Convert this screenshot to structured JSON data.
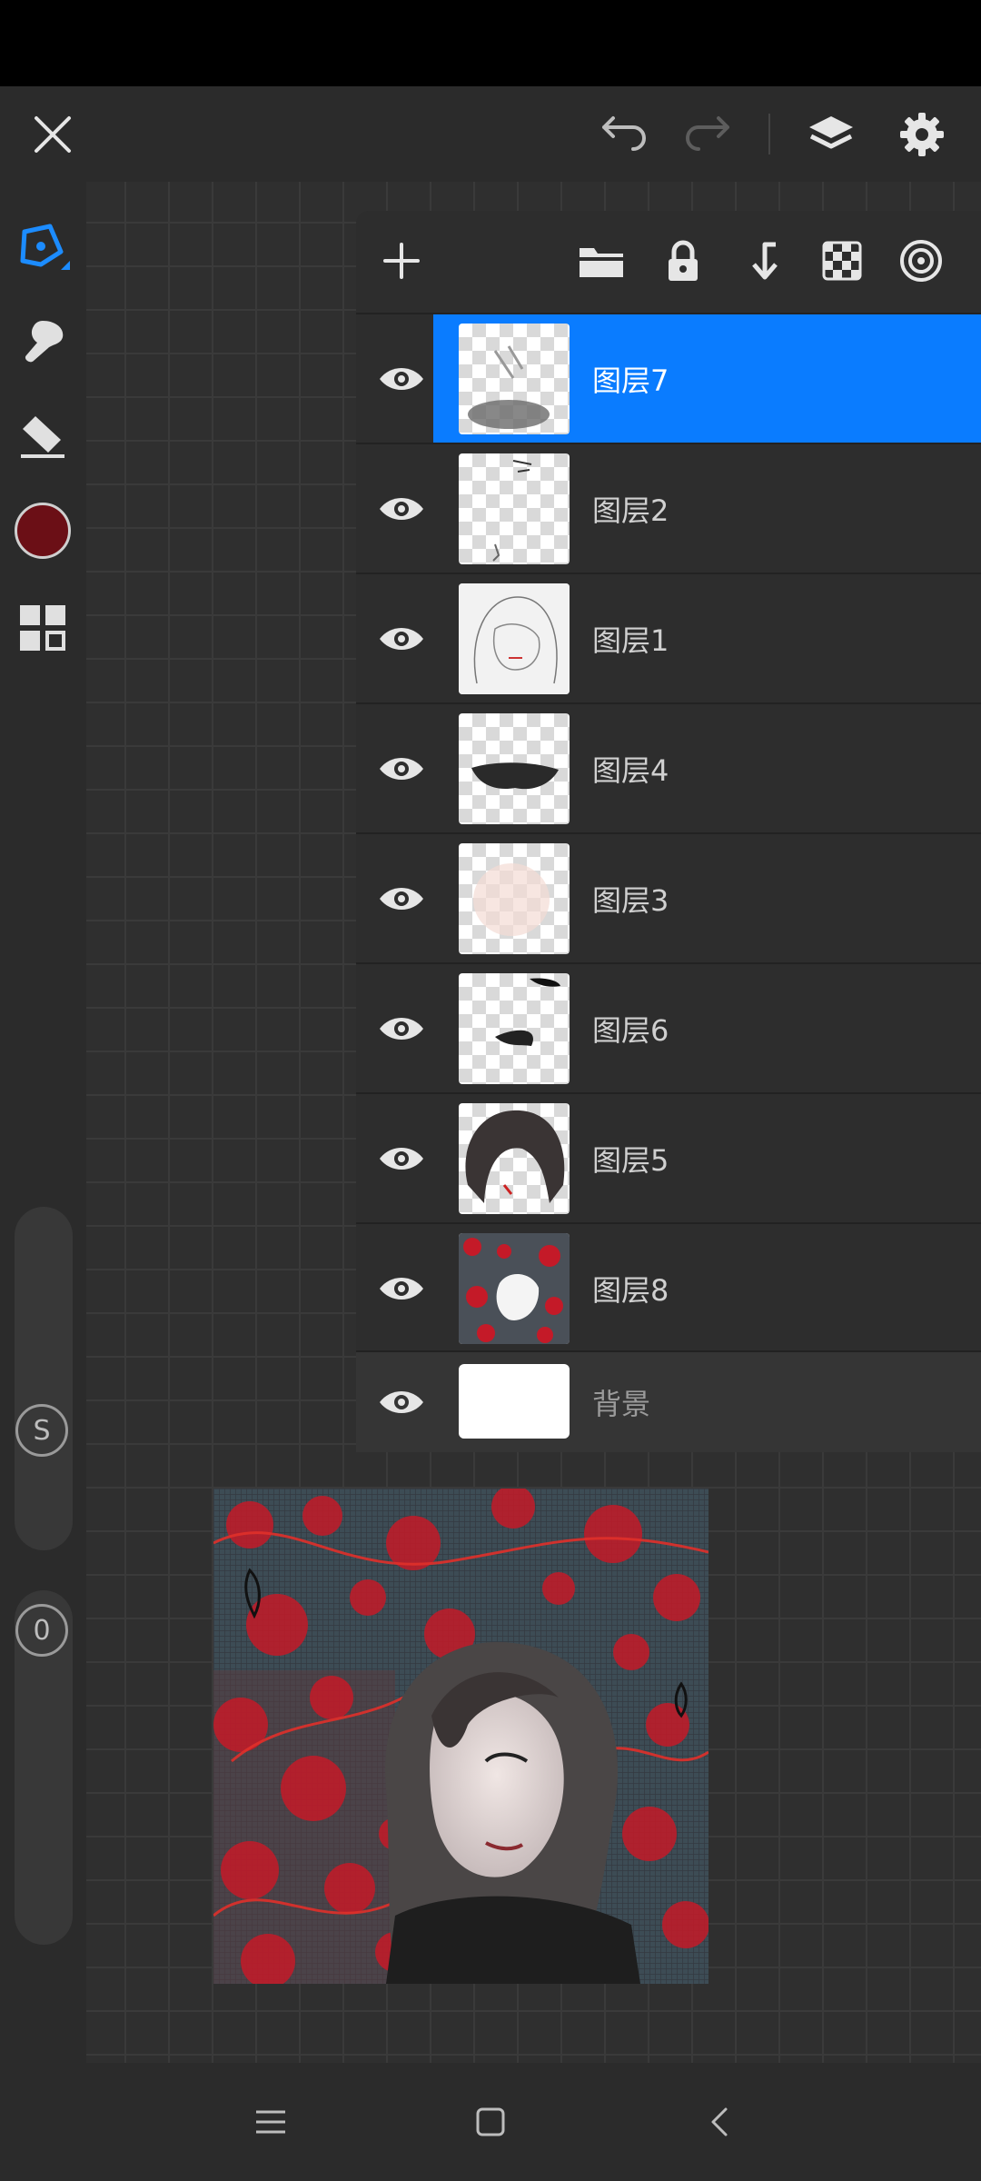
{
  "colors": {
    "accent": "#0a7cff",
    "current_color": "#6b0f16",
    "panel": "#2d2d2d",
    "background": "#2a2a2a"
  },
  "toolbar": {
    "close_icon": "close-icon",
    "undo_icon": "undo-icon",
    "redo_icon": "redo-icon",
    "layers_icon": "layers-icon",
    "settings_icon": "gear-icon"
  },
  "tools": [
    {
      "name": "pen",
      "icon": "pen-icon",
      "active": true
    },
    {
      "name": "smudge",
      "icon": "smudge-icon",
      "active": false
    },
    {
      "name": "eraser",
      "icon": "eraser-icon",
      "active": false
    },
    {
      "name": "color",
      "icon": "color-swatch",
      "active": false
    },
    {
      "name": "more",
      "icon": "grid-icon",
      "active": false
    }
  ],
  "sliders": {
    "size_label": "S",
    "opacity_label": "0"
  },
  "layers_panel": {
    "tools": [
      "add-icon",
      "folder-icon",
      "lock-icon",
      "merge-down-icon",
      "checker-icon",
      "target-icon"
    ],
    "layers": [
      {
        "name": "图层7",
        "visible": true,
        "selected": true
      },
      {
        "name": "图层2",
        "visible": true,
        "selected": false
      },
      {
        "name": "图层1",
        "visible": true,
        "selected": false
      },
      {
        "name": "图层4",
        "visible": true,
        "selected": false
      },
      {
        "name": "图层3",
        "visible": true,
        "selected": false
      },
      {
        "name": "图层6",
        "visible": true,
        "selected": false
      },
      {
        "name": "图层5",
        "visible": true,
        "selected": false
      },
      {
        "name": "图层8",
        "visible": true,
        "selected": false
      }
    ],
    "background_layer": {
      "name": "背景",
      "visible": true
    }
  },
  "navbar": [
    "menu-icon",
    "home-icon",
    "back-icon"
  ]
}
